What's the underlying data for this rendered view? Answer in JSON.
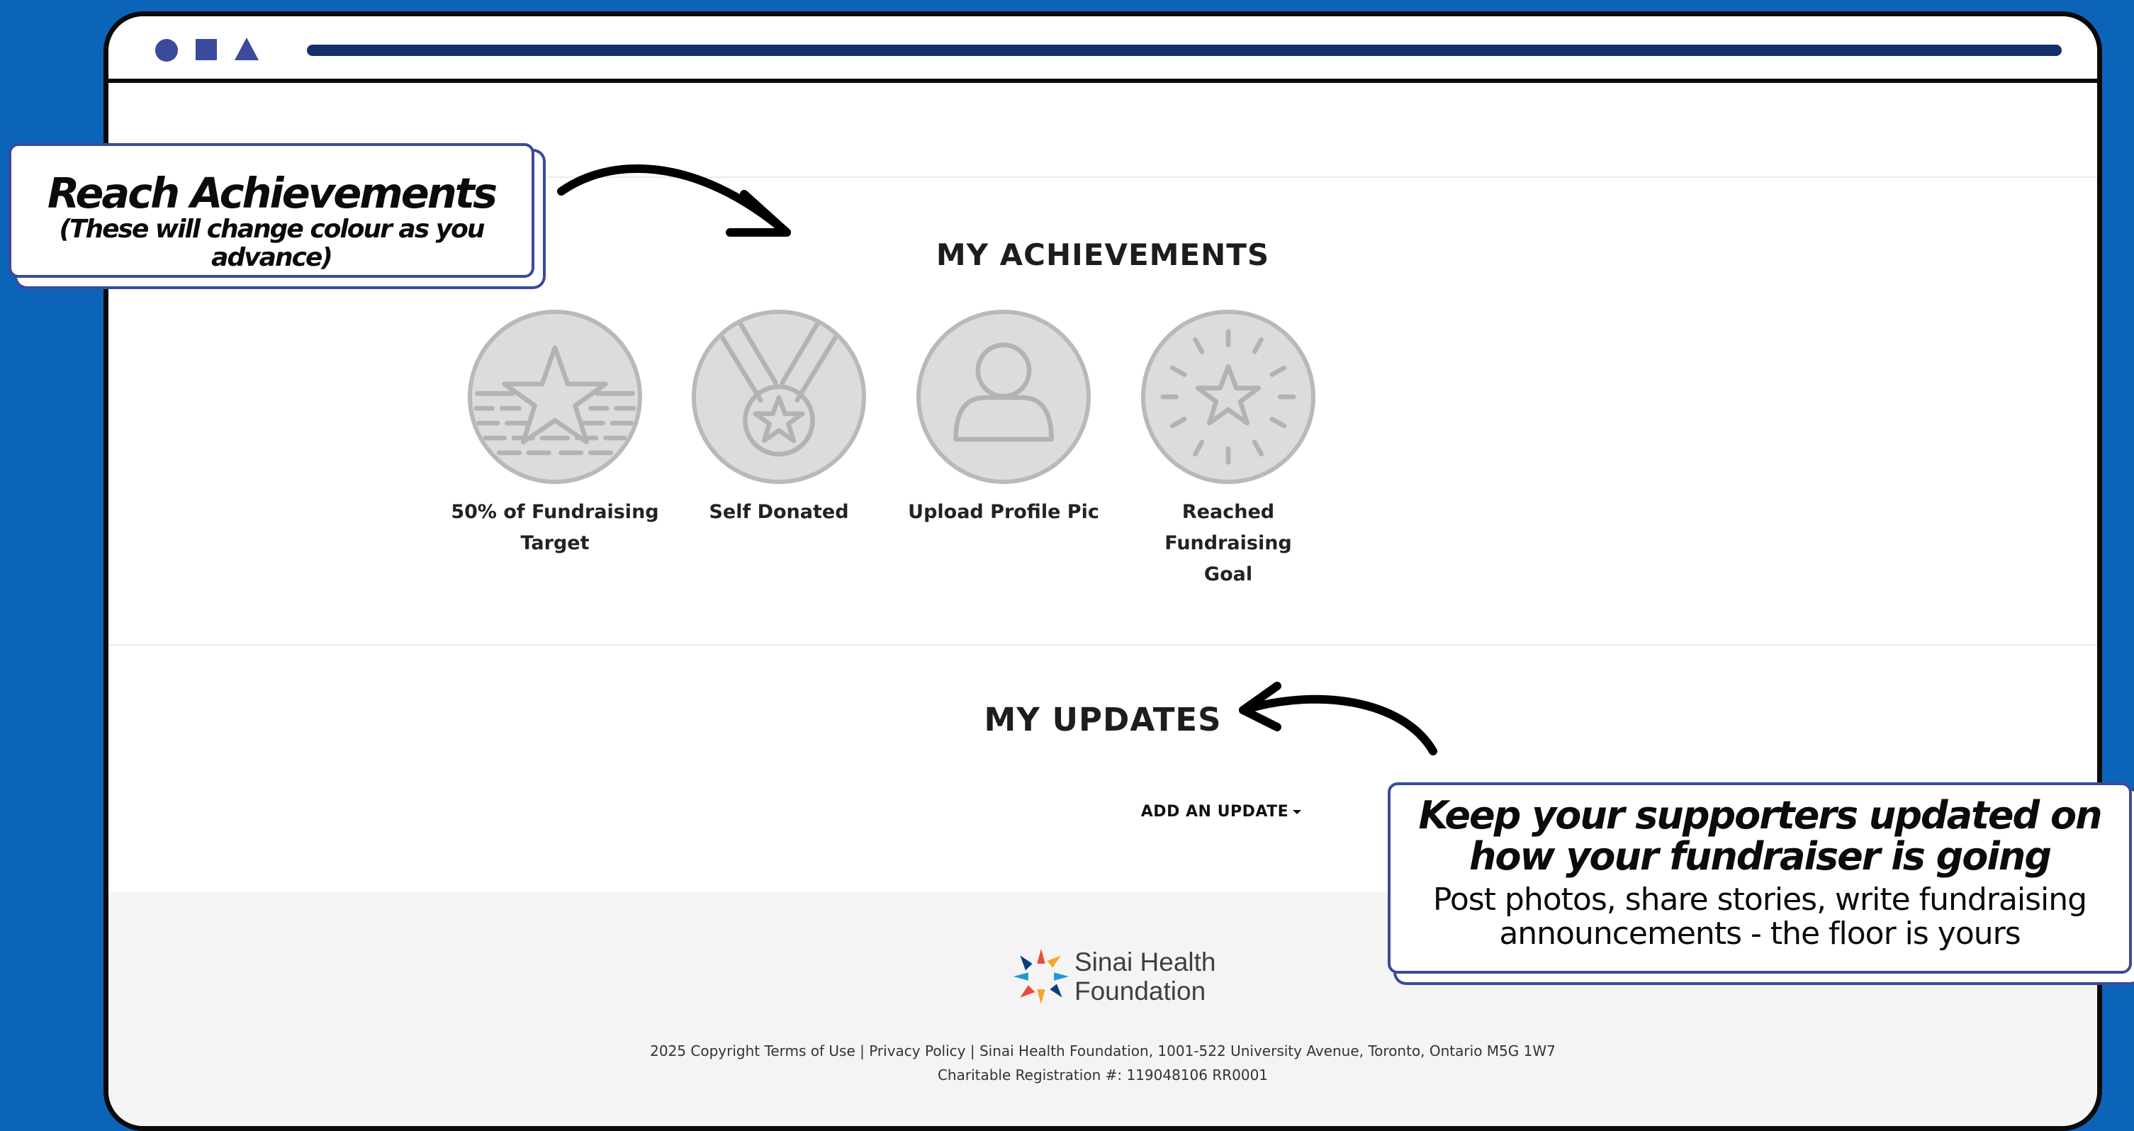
{
  "achievements": {
    "title": "MY ACHIEVEMENTS",
    "badges": [
      {
        "label": "50% of Fundraising Target",
        "icon": "star-bars-icon"
      },
      {
        "label": "Self Donated",
        "icon": "medal-icon"
      },
      {
        "label": "Upload Profile Pic",
        "icon": "profile-person-icon"
      },
      {
        "label": "Reached Fundraising Goal",
        "icon": "shining-star-icon"
      }
    ]
  },
  "updates": {
    "title": "MY UPDATES",
    "add_update_label": "ADD AN UPDATE"
  },
  "footer": {
    "logo_line1": "Sinai Health",
    "logo_line2": "Foundation",
    "legal_line": "2025 Copyright Terms of Use | Privacy Policy | Sinai Health Foundation, 1001-522 University Avenue, Toronto, Ontario M5G 1W7",
    "registration_line": "Charitable Registration #: 119048106 RR0001"
  },
  "callouts": {
    "achievements_title": "Reach Achievements",
    "achievements_subtitle": "(These will change colour as you advance)",
    "updates_title": "Keep your supporters updated on how your fundraiser is going",
    "updates_body": "Post photos, share stories, write fundraising announcements - the floor is yours"
  },
  "colors": {
    "background": "#0c64b9",
    "accent": "#3b4a9a",
    "badge_gray": "#dcdcdc",
    "footer_bg": "#f4f4f4"
  }
}
